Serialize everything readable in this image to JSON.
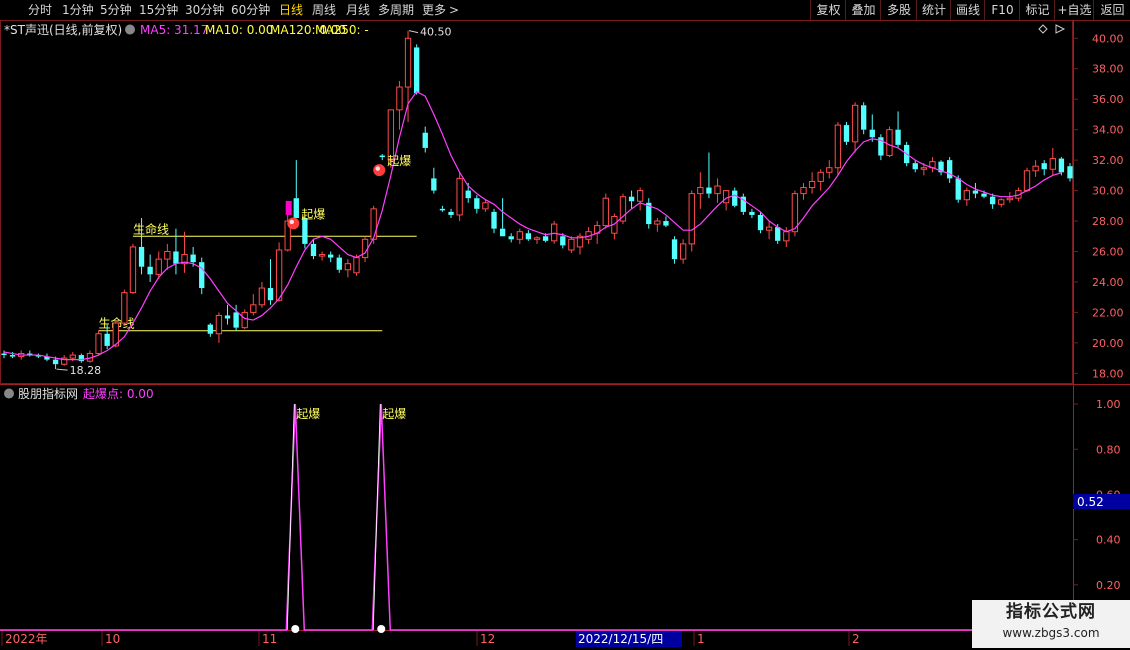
{
  "toolbar": {
    "left": [
      {
        "id": "fenshi",
        "label": "分时"
      },
      {
        "id": "1min",
        "label": "1分钟"
      },
      {
        "id": "5min",
        "label": "5分钟"
      },
      {
        "id": "15min",
        "label": "15分钟"
      },
      {
        "id": "30min",
        "label": "30分钟"
      },
      {
        "id": "60min",
        "label": "60分钟"
      },
      {
        "id": "day",
        "label": "日线",
        "active": true
      },
      {
        "id": "week",
        "label": "周线"
      },
      {
        "id": "month",
        "label": "月线"
      },
      {
        "id": "multi",
        "label": "多周期"
      },
      {
        "id": "more",
        "label": "更多"
      }
    ],
    "right": [
      {
        "id": "fuquan",
        "label": "复权"
      },
      {
        "id": "diejia",
        "label": "叠加"
      },
      {
        "id": "duogu",
        "label": "多股"
      },
      {
        "id": "tongji",
        "label": "统计"
      },
      {
        "id": "huaxian",
        "label": "画线"
      },
      {
        "id": "f10",
        "label": "F10"
      },
      {
        "id": "biaoji",
        "label": "标记"
      },
      {
        "id": "zixuan",
        "label": "+自选"
      },
      {
        "id": "fanhui",
        "label": "返回"
      }
    ]
  },
  "main_header": {
    "stock": "*ST声迅(日线,前复权)",
    "ma5": "MA5: 31.17",
    "ma10": "MA10: 0.00",
    "ma120": "MA120: 0.00",
    "ma250": "MA250: -"
  },
  "sub_header": {
    "source": "股朋指标网",
    "indicator": "起爆点: 0.00"
  },
  "annotations": {
    "high_label": "40.50",
    "low_label": "18.28",
    "lifeline_1": "生命线",
    "lifeline_2": "生命线",
    "burst_1": "起爆",
    "burst_2": "起爆",
    "sub_burst_1": "起爆",
    "sub_burst_2": "起爆"
  },
  "cursor_value": "0.52",
  "x_axis": {
    "labels": [
      {
        "key": "y2022",
        "text": "2022年"
      },
      {
        "key": "m10",
        "text": "10"
      },
      {
        "key": "m11",
        "text": "11"
      },
      {
        "key": "m12",
        "text": "12"
      },
      {
        "key": "m1",
        "text": "1"
      },
      {
        "key": "m2",
        "text": "2"
      }
    ],
    "cursor_date": "2022/12/15/四"
  },
  "watermark": {
    "line1": "指标公式网",
    "line2": "www.zbgs3.com"
  },
  "colors": {
    "up": "#ff4a4a",
    "down": "#54ffff",
    "ma5": "#ff40ff",
    "lifeline": "#ffff60",
    "frame": "#7a1a1a",
    "axis_text": "#ff6060",
    "burst_line": "#ff40ff"
  },
  "chart_data": [
    {
      "type": "candlestick",
      "y_axis": {
        "ticks": [
          18,
          20,
          22,
          24,
          26,
          28,
          30,
          32,
          34,
          36,
          38,
          40
        ],
        "ylim": [
          17.3,
          41.2
        ]
      },
      "grid": false,
      "candles": [
        {
          "o": 19.3,
          "h": 19.5,
          "l": 19.0,
          "c": 19.2
        },
        {
          "o": 19.2,
          "h": 19.4,
          "l": 19.0,
          "c": 19.1
        },
        {
          "o": 19.1,
          "h": 19.5,
          "l": 18.9,
          "c": 19.3
        },
        {
          "o": 19.3,
          "h": 19.5,
          "l": 19.1,
          "c": 19.2
        },
        {
          "o": 19.2,
          "h": 19.3,
          "l": 19.0,
          "c": 19.1
        },
        {
          "o": 19.1,
          "h": 19.3,
          "l": 18.8,
          "c": 18.9
        },
        {
          "o": 18.9,
          "h": 19.1,
          "l": 18.28,
          "c": 18.6
        },
        {
          "o": 18.6,
          "h": 19.2,
          "l": 18.5,
          "c": 19.0
        },
        {
          "o": 19.0,
          "h": 19.4,
          "l": 18.8,
          "c": 19.2
        },
        {
          "o": 19.2,
          "h": 19.3,
          "l": 18.7,
          "c": 18.8
        },
        {
          "o": 18.8,
          "h": 19.5,
          "l": 18.7,
          "c": 19.3
        },
        {
          "o": 19.3,
          "h": 20.8,
          "l": 19.2,
          "c": 20.6
        },
        {
          "o": 20.6,
          "h": 21.2,
          "l": 19.6,
          "c": 19.8
        },
        {
          "o": 19.8,
          "h": 21.5,
          "l": 19.7,
          "c": 21.3
        },
        {
          "o": 21.3,
          "h": 23.5,
          "l": 21.2,
          "c": 23.3
        },
        {
          "o": 23.3,
          "h": 26.5,
          "l": 23.2,
          "c": 26.3
        },
        {
          "o": 26.3,
          "h": 28.2,
          "l": 24.5,
          "c": 25.0
        },
        {
          "o": 25.0,
          "h": 25.8,
          "l": 24.0,
          "c": 24.5
        },
        {
          "o": 24.5,
          "h": 26.0,
          "l": 24.2,
          "c": 25.5
        },
        {
          "o": 25.5,
          "h": 26.5,
          "l": 24.8,
          "c": 26.0
        },
        {
          "o": 26.0,
          "h": 27.5,
          "l": 24.5,
          "c": 25.2
        },
        {
          "o": 25.2,
          "h": 27.3,
          "l": 24.6,
          "c": 25.8
        },
        {
          "o": 25.8,
          "h": 26.3,
          "l": 25.0,
          "c": 25.3
        },
        {
          "o": 25.3,
          "h": 25.6,
          "l": 23.2,
          "c": 23.6
        },
        {
          "o": 21.2,
          "h": 21.3,
          "l": 20.4,
          "c": 20.6
        },
        {
          "o": 20.6,
          "h": 22.0,
          "l": 20.0,
          "c": 21.8
        },
        {
          "o": 21.8,
          "h": 22.5,
          "l": 21.2,
          "c": 21.6
        },
        {
          "o": 22.0,
          "h": 22.5,
          "l": 20.8,
          "c": 21.0
        },
        {
          "o": 21.0,
          "h": 22.2,
          "l": 20.9,
          "c": 22.0
        },
        {
          "o": 22.0,
          "h": 23.2,
          "l": 21.8,
          "c": 22.5
        },
        {
          "o": 22.5,
          "h": 24.0,
          "l": 22.3,
          "c": 23.6
        },
        {
          "o": 23.6,
          "h": 25.5,
          "l": 22.5,
          "c": 22.8
        },
        {
          "o": 22.8,
          "h": 26.6,
          "l": 22.7,
          "c": 26.1
        },
        {
          "o": 26.1,
          "h": 28.4,
          "l": 26.0,
          "c": 28.0
        },
        {
          "o": 29.5,
          "h": 32.0,
          "l": 28.5,
          "c": 28.2
        },
        {
          "o": 28.2,
          "h": 28.4,
          "l": 26.2,
          "c": 26.5
        },
        {
          "o": 26.5,
          "h": 26.8,
          "l": 25.5,
          "c": 25.7
        },
        {
          "o": 25.7,
          "h": 26.0,
          "l": 25.4,
          "c": 25.8
        },
        {
          "o": 25.8,
          "h": 26.0,
          "l": 25.3,
          "c": 25.6
        },
        {
          "o": 25.6,
          "h": 25.8,
          "l": 24.6,
          "c": 24.8
        },
        {
          "o": 24.8,
          "h": 25.5,
          "l": 24.3,
          "c": 25.2
        },
        {
          "o": 24.6,
          "h": 25.8,
          "l": 24.4,
          "c": 25.6
        },
        {
          "o": 25.6,
          "h": 27.0,
          "l": 25.3,
          "c": 26.8
        },
        {
          "o": 26.8,
          "h": 29.0,
          "l": 26.5,
          "c": 28.8
        },
        {
          "o": 32.3,
          "h": 32.4,
          "l": 32.0,
          "c": 32.2
        },
        {
          "o": 32.0,
          "h": 35.0,
          "l": 31.5,
          "c": 35.3
        },
        {
          "o": 35.3,
          "h": 37.2,
          "l": 34.0,
          "c": 36.8
        },
        {
          "o": 36.8,
          "h": 40.5,
          "l": 34.5,
          "c": 40.0
        },
        {
          "o": 39.4,
          "h": 39.6,
          "l": 36.3,
          "c": 36.4
        },
        {
          "o": 33.8,
          "h": 34.2,
          "l": 32.5,
          "c": 32.8
        },
        {
          "o": 30.8,
          "h": 31.5,
          "l": 29.8,
          "c": 30.0
        },
        {
          "o": 28.8,
          "h": 29.0,
          "l": 28.6,
          "c": 28.7
        },
        {
          "o": 28.6,
          "h": 28.8,
          "l": 28.2,
          "c": 28.4
        },
        {
          "o": 28.4,
          "h": 31.2,
          "l": 28.0,
          "c": 30.8
        },
        {
          "o": 30.0,
          "h": 30.5,
          "l": 29.2,
          "c": 29.5
        },
        {
          "o": 29.5,
          "h": 29.7,
          "l": 28.5,
          "c": 28.8
        },
        {
          "o": 28.8,
          "h": 29.4,
          "l": 28.6,
          "c": 29.2
        },
        {
          "o": 28.6,
          "h": 28.8,
          "l": 27.2,
          "c": 27.5
        },
        {
          "o": 27.5,
          "h": 29.5,
          "l": 27.0,
          "c": 27.0
        },
        {
          "o": 27.0,
          "h": 27.2,
          "l": 26.6,
          "c": 26.8
        },
        {
          "o": 26.8,
          "h": 27.5,
          "l": 26.5,
          "c": 27.3
        },
        {
          "o": 27.2,
          "h": 27.4,
          "l": 26.7,
          "c": 26.8
        },
        {
          "o": 26.8,
          "h": 27.0,
          "l": 26.5,
          "c": 26.9
        },
        {
          "o": 27.0,
          "h": 27.2,
          "l": 26.6,
          "c": 26.7
        },
        {
          "o": 26.7,
          "h": 28.0,
          "l": 26.5,
          "c": 27.8
        },
        {
          "o": 27.0,
          "h": 27.2,
          "l": 26.2,
          "c": 26.4
        },
        {
          "o": 26.1,
          "h": 27.0,
          "l": 25.9,
          "c": 26.8
        },
        {
          "o": 26.3,
          "h": 27.2,
          "l": 25.8,
          "c": 27.0
        },
        {
          "o": 26.8,
          "h": 27.6,
          "l": 26.5,
          "c": 27.3
        },
        {
          "o": 27.2,
          "h": 28.0,
          "l": 26.5,
          "c": 27.7
        },
        {
          "o": 27.7,
          "h": 29.8,
          "l": 27.5,
          "c": 29.5
        },
        {
          "o": 27.2,
          "h": 28.5,
          "l": 26.8,
          "c": 28.3
        },
        {
          "o": 28.0,
          "h": 29.8,
          "l": 27.8,
          "c": 29.6
        },
        {
          "o": 29.6,
          "h": 30.0,
          "l": 28.8,
          "c": 29.3
        },
        {
          "o": 29.3,
          "h": 30.2,
          "l": 28.7,
          "c": 30.0
        },
        {
          "o": 29.2,
          "h": 29.5,
          "l": 27.5,
          "c": 27.8
        },
        {
          "o": 27.8,
          "h": 28.2,
          "l": 27.3,
          "c": 28.0
        },
        {
          "o": 28.0,
          "h": 28.3,
          "l": 27.6,
          "c": 27.7
        },
        {
          "o": 26.8,
          "h": 27.0,
          "l": 25.2,
          "c": 25.5
        },
        {
          "o": 25.5,
          "h": 26.8,
          "l": 25.2,
          "c": 26.5
        },
        {
          "o": 26.5,
          "h": 30.0,
          "l": 26.0,
          "c": 29.8
        },
        {
          "o": 29.8,
          "h": 31.2,
          "l": 28.8,
          "c": 30.2
        },
        {
          "o": 30.2,
          "h": 32.5,
          "l": 29.5,
          "c": 29.8
        },
        {
          "o": 29.8,
          "h": 30.8,
          "l": 29.2,
          "c": 30.3
        },
        {
          "o": 29.2,
          "h": 30.0,
          "l": 28.7,
          "c": 30.0
        },
        {
          "o": 30.0,
          "h": 30.2,
          "l": 28.9,
          "c": 29.0
        },
        {
          "o": 29.6,
          "h": 29.8,
          "l": 28.4,
          "c": 28.6
        },
        {
          "o": 28.6,
          "h": 28.8,
          "l": 28.2,
          "c": 28.4
        },
        {
          "o": 28.4,
          "h": 28.6,
          "l": 27.2,
          "c": 27.4
        },
        {
          "o": 27.4,
          "h": 28.0,
          "l": 26.8,
          "c": 27.6
        },
        {
          "o": 27.6,
          "h": 27.8,
          "l": 26.5,
          "c": 26.7
        },
        {
          "o": 26.7,
          "h": 27.6,
          "l": 26.3,
          "c": 27.3
        },
        {
          "o": 27.3,
          "h": 30.0,
          "l": 27.0,
          "c": 29.8
        },
        {
          "o": 29.8,
          "h": 30.5,
          "l": 29.4,
          "c": 30.2
        },
        {
          "o": 30.2,
          "h": 31.2,
          "l": 29.8,
          "c": 30.6
        },
        {
          "o": 30.6,
          "h": 31.4,
          "l": 30.0,
          "c": 31.2
        },
        {
          "o": 31.2,
          "h": 32.0,
          "l": 30.8,
          "c": 31.5
        },
        {
          "o": 31.5,
          "h": 34.5,
          "l": 31.0,
          "c": 34.3
        },
        {
          "o": 34.3,
          "h": 34.5,
          "l": 33.0,
          "c": 33.2
        },
        {
          "o": 33.2,
          "h": 35.8,
          "l": 32.5,
          "c": 35.6
        },
        {
          "o": 35.6,
          "h": 35.8,
          "l": 33.7,
          "c": 34.0
        },
        {
          "o": 34.0,
          "h": 35.0,
          "l": 33.2,
          "c": 33.5
        },
        {
          "o": 33.5,
          "h": 33.7,
          "l": 32.0,
          "c": 32.3
        },
        {
          "o": 32.3,
          "h": 34.2,
          "l": 32.2,
          "c": 34.0
        },
        {
          "o": 34.0,
          "h": 35.2,
          "l": 32.8,
          "c": 33.0
        },
        {
          "o": 33.0,
          "h": 33.2,
          "l": 31.6,
          "c": 31.8
        },
        {
          "o": 31.8,
          "h": 32.0,
          "l": 31.2,
          "c": 31.4
        },
        {
          "o": 31.4,
          "h": 31.8,
          "l": 31.0,
          "c": 31.5
        },
        {
          "o": 31.5,
          "h": 32.2,
          "l": 31.2,
          "c": 31.9
        },
        {
          "o": 31.9,
          "h": 32.0,
          "l": 31.0,
          "c": 31.2
        },
        {
          "o": 32.0,
          "h": 32.2,
          "l": 30.5,
          "c": 30.8
        },
        {
          "o": 30.8,
          "h": 31.0,
          "l": 29.2,
          "c": 29.4
        },
        {
          "o": 29.4,
          "h": 30.2,
          "l": 29.0,
          "c": 30.0
        },
        {
          "o": 30.0,
          "h": 30.5,
          "l": 29.5,
          "c": 29.8
        },
        {
          "o": 29.8,
          "h": 30.0,
          "l": 29.5,
          "c": 29.6
        },
        {
          "o": 29.6,
          "h": 29.8,
          "l": 28.8,
          "c": 29.1
        },
        {
          "o": 29.1,
          "h": 29.5,
          "l": 28.9,
          "c": 29.4
        },
        {
          "o": 29.4,
          "h": 29.9,
          "l": 29.2,
          "c": 29.5
        },
        {
          "o": 29.5,
          "h": 30.2,
          "l": 29.3,
          "c": 30.0
        },
        {
          "o": 30.0,
          "h": 31.5,
          "l": 29.9,
          "c": 31.3
        },
        {
          "o": 31.3,
          "h": 32.0,
          "l": 30.9,
          "c": 31.6
        },
        {
          "o": 31.8,
          "h": 32.0,
          "l": 31.0,
          "c": 31.4
        },
        {
          "o": 31.4,
          "h": 32.8,
          "l": 31.0,
          "c": 32.1
        },
        {
          "o": 32.1,
          "h": 32.2,
          "l": 31.0,
          "c": 31.2
        },
        {
          "o": 31.6,
          "h": 31.8,
          "l": 30.6,
          "c": 30.8
        }
      ],
      "ma5": [
        19.4,
        19.3,
        19.2,
        19.2,
        19.2,
        19.1,
        19.0,
        18.9,
        18.9,
        18.9,
        19.0,
        19.2,
        19.5,
        19.9,
        20.4,
        21.3,
        22.3,
        23.4,
        24.3,
        24.9,
        25.2,
        25.3,
        25.2,
        24.9,
        24.2,
        23.4,
        22.6,
        22.1,
        21.6,
        21.5,
        21.8,
        22.3,
        22.9,
        23.8,
        25.0,
        26.1,
        26.8,
        27.0,
        26.8,
        26.3,
        25.8,
        25.6,
        25.9,
        26.9,
        28.7,
        31.0,
        33.5,
        35.7,
        36.5,
        36.2,
        35.0,
        33.7,
        32.3,
        31.2,
        30.3,
        29.8,
        29.4,
        29.1,
        28.6,
        28.2,
        27.8,
        27.5,
        27.3,
        27.1,
        27.2,
        27.1,
        26.9,
        26.9,
        27.0,
        27.2,
        27.6,
        27.8,
        28.3,
        28.8,
        29.2,
        29.0,
        28.8,
        28.4,
        27.9,
        27.4,
        27.4,
        27.8,
        28.4,
        29.0,
        29.5,
        29.7,
        29.4,
        29.0,
        28.6,
        28.0,
        27.6,
        27.3,
        27.5,
        28.2,
        29.0,
        29.6,
        30.2,
        31.0,
        31.9,
        32.6,
        33.2,
        33.4,
        33.3,
        33.0,
        32.8,
        32.4,
        32.0,
        31.7,
        31.5,
        31.3,
        31.1,
        30.8,
        30.4,
        30.1,
        29.9,
        29.7,
        29.6,
        29.6,
        29.7,
        30.0,
        30.3,
        30.7,
        31.0,
        31.17
      ],
      "burst_markers": [
        34,
        44
      ],
      "lifelines": [
        {
          "label_key": "lifeline_1",
          "price": 27.0,
          "from": 15,
          "to": 48
        },
        {
          "label_key": "lifeline_2",
          "price": 20.8,
          "from": 11,
          "to": 44
        }
      ]
    },
    {
      "type": "line",
      "name": "起爆点",
      "y_axis": {
        "ticks": [
          0.2,
          0.4,
          0.6,
          0.8,
          1.0
        ],
        "ylim": [
          0.0,
          1.08
        ]
      },
      "spikes": [
        34,
        44
      ],
      "cursor": 0.52
    }
  ]
}
